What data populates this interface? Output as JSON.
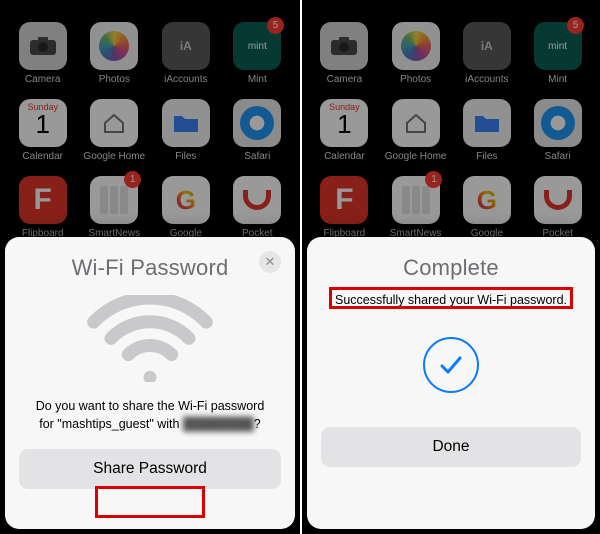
{
  "homescreen": {
    "apps": [
      {
        "name": "Camera",
        "iconClass": "ic-camera",
        "glyph": "camera"
      },
      {
        "name": "Photos",
        "iconClass": "ic-photos",
        "glyph": "photos"
      },
      {
        "name": "iAccounts",
        "iconClass": "ic-iaccounts",
        "glyph": "ia"
      },
      {
        "name": "Mint",
        "iconClass": "ic-mint",
        "glyph": "mint",
        "badge": "5"
      },
      {
        "name": "Calendar",
        "iconClass": "ic-calendar",
        "glyph": "calendar",
        "cal_top": "Sunday",
        "cal_num": "1"
      },
      {
        "name": "Google Home",
        "iconClass": "ic-googlehome",
        "glyph": "house"
      },
      {
        "name": "Files",
        "iconClass": "ic-files",
        "glyph": "folder"
      },
      {
        "name": "Safari",
        "iconClass": "ic-safari",
        "glyph": "safari"
      },
      {
        "name": "Flipboard",
        "iconClass": "ic-flipboard",
        "glyph": "flip"
      },
      {
        "name": "SmartNews",
        "iconClass": "ic-smartnews",
        "glyph": "smartnews",
        "badge": "1"
      },
      {
        "name": "Google",
        "iconClass": "ic-google",
        "glyph": "gletter"
      },
      {
        "name": "Pocket",
        "iconClass": "ic-pocket",
        "glyph": "pocket"
      }
    ]
  },
  "sheet_left": {
    "title": "Wi-Fi Password",
    "close_label": "✕",
    "message_pre": "Do you want to share the Wi-Fi password for \"",
    "network_name": "mashtips_guest",
    "message_mid": "\" with ",
    "contact_name_hidden": "████████",
    "message_post": "?",
    "button_label": "Share Password"
  },
  "sheet_right": {
    "title": "Complete",
    "message": "Successfully shared your Wi-Fi password.",
    "button_label": "Done"
  },
  "colors": {
    "annotation": "#da0000",
    "accent_blue": "#0a7aff"
  }
}
